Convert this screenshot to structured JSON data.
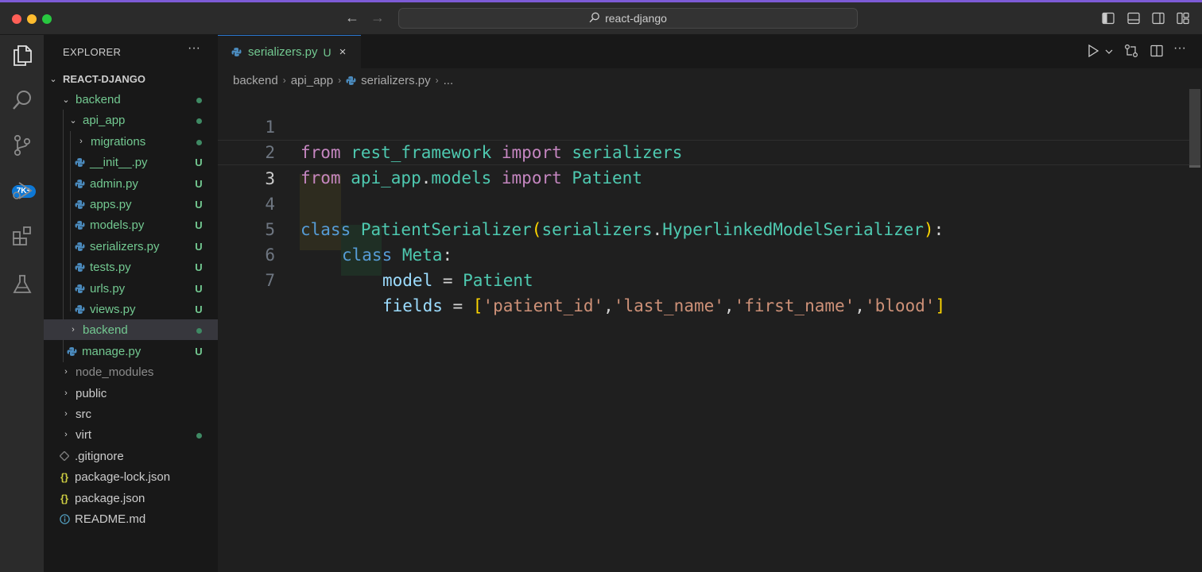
{
  "window": {
    "search_text": "react-django"
  },
  "activity_bar": {
    "badge": "7K+"
  },
  "explorer": {
    "title": "EXPLORER",
    "more": "···",
    "root": "REACT-DJANGO",
    "items": [
      {
        "label": "backend",
        "status": ""
      },
      {
        "label": "api_app",
        "status": ""
      },
      {
        "label": "migrations",
        "status": ""
      },
      {
        "label": "__init__.py",
        "status": "U"
      },
      {
        "label": "admin.py",
        "status": "U"
      },
      {
        "label": "apps.py",
        "status": "U"
      },
      {
        "label": "models.py",
        "status": "U"
      },
      {
        "label": "serializers.py",
        "status": "U"
      },
      {
        "label": "tests.py",
        "status": "U"
      },
      {
        "label": "urls.py",
        "status": "U"
      },
      {
        "label": "views.py",
        "status": "U"
      },
      {
        "label": "backend",
        "status": ""
      },
      {
        "label": "manage.py",
        "status": "U"
      },
      {
        "label": "node_modules",
        "status": ""
      },
      {
        "label": "public",
        "status": ""
      },
      {
        "label": "src",
        "status": ""
      },
      {
        "label": "virt",
        "status": ""
      },
      {
        "label": ".gitignore",
        "status": ""
      },
      {
        "label": "package-lock.json",
        "status": ""
      },
      {
        "label": "package.json",
        "status": ""
      },
      {
        "label": "README.md",
        "status": ""
      }
    ]
  },
  "editor": {
    "tab": {
      "label": "serializers.py",
      "status": "U",
      "close": "×"
    },
    "breadcrumb": {
      "parts": [
        "backend",
        "api_app",
        "serializers.py",
        "..."
      ]
    },
    "line_numbers": [
      "1",
      "2",
      "3",
      "4",
      "5",
      "6",
      "7"
    ],
    "code": {
      "l1": {
        "a": "from",
        "b": " rest_framework ",
        "c": "import",
        "d": " serializers"
      },
      "l2": {
        "a": "from",
        "b": " api_app",
        "c": ".",
        "d": "models",
        "e": " import",
        "f": " Patient"
      },
      "l4": {
        "a": "class",
        "b": " PatientSerializer",
        "c": "(",
        "d": "serializers",
        "e": ".",
        "f": "HyperlinkedModelSerializer",
        "g": ")",
        "h": ":"
      },
      "l5": {
        "a": "class",
        "b": " Meta",
        "c": ":"
      },
      "l6": {
        "a": "model",
        "b": " = ",
        "c": "Patient"
      },
      "l7": {
        "a": "fields",
        "b": " = ",
        "c": "[",
        "d": "'patient_id'",
        "e": ",",
        "f": "'last_name'",
        "g": ",",
        "h": "'first_name'",
        "i": ",",
        "j": "'blood'",
        "k": "]"
      }
    }
  },
  "colors": {
    "accent": "#7d5bd6",
    "untracked": "#73c991",
    "badge": "#0e78d5"
  }
}
